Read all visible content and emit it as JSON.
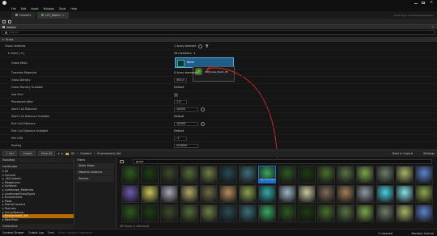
{
  "window": {
    "title_left": "",
    "title_right": ""
  },
  "menu": [
    "File",
    "Edit",
    "Asset",
    "Window",
    "Tools",
    "Help"
  ],
  "tabs": [
    {
      "label": "Forest01",
      "active": false
    },
    {
      "label": "LGT_Waterl",
      "active": true
    }
  ],
  "tab_right_text": "Asset Type: LandscapeGrassType",
  "toolbar": {
    "label": "Details",
    "text": "Details"
  },
  "search_placeholder": "Search",
  "section_grass": "Grass",
  "props": {
    "grass_varieties": {
      "label": "Grass Varieties",
      "value": "1 Array element"
    },
    "index0": {
      "label": "▾ Index [ 0 ]",
      "value": "26 members"
    },
    "grass_mesh": {
      "label": "Grass Mesh",
      "value": "None"
    },
    "override_materials": {
      "label": "Override Materials",
      "value": "0 Array elements"
    },
    "grass_density": {
      "label": "Grass Density",
      "value": "400.0"
    },
    "grass_density_scalable": {
      "label": "Grass Density Scalable",
      "value": "Default"
    },
    "use_grid": {
      "label": "Use Grid",
      "value": ""
    },
    "placement_jitter": {
      "label": "Placement Jitter",
      "value": "1.0"
    },
    "start_cull_distance": {
      "label": "Start Cull Distance",
      "value": "10000"
    },
    "start_cull_distance_scalable": {
      "label": "Start Cull Distance Scalable",
      "value": "Default"
    },
    "end_cull_distance": {
      "label": "End Cull Distance",
      "value": "10000"
    },
    "end_cull_distance_scalable": {
      "label": "End Cull Distance Scalable",
      "value": "Default"
    },
    "min_lod": {
      "label": "Min LOD",
      "value": "-1"
    },
    "scaling": {
      "label": "Scaling",
      "value": "Uniform"
    }
  },
  "dropdown_asset": "SM_Grass_Bush_05",
  "content_browser": {
    "add": "+ Add",
    "import": "Import",
    "save_all": "Save All",
    "breadcrumb": [
      "All",
      "Content",
      "Environment_Set"
    ],
    "dock": "Dock in Layout",
    "settings": "Settings"
  },
  "favorites": "Favorites",
  "landscape": "Landscape",
  "tree": [
    "▾ All",
    "  ▾ Content",
    "    ▸ _MyContent",
    "    ▸ Megascans",
    "      ▸ Surfaces",
    "        ▸ Landscape_Materials",
    "    ▸ LandscapeGrassTypes",
    "    ▸ Environment",
    "    ▸ Maps",
    "    ▸ StarterContent",
    "    ▸ Textures",
    "    ▸ VirtualTexture",
    "  ▸ Environment_Set",
    "  ▸ MeshPack"
  ],
  "collections": "Collections",
  "filters": {
    "title": "Filters",
    "items": [
      "Static Mesh",
      "Material Instance",
      "Texture"
    ]
  },
  "asset_search": "grass",
  "asset_count": "40 items (1 selected)",
  "selected_tile": "SM_Grass_Bush_05",
  "status": {
    "content_drawer": "Content Drawer",
    "output_log": "Output Log",
    "cmd": "Cmd",
    "console": "Enter Console Command",
    "unsaved": "1 Unsaved",
    "revision": "Revision Control"
  },
  "colors": {
    "accent": "#e0a000",
    "arrow": "#d42a2a",
    "selection": "#1a6fd0"
  }
}
